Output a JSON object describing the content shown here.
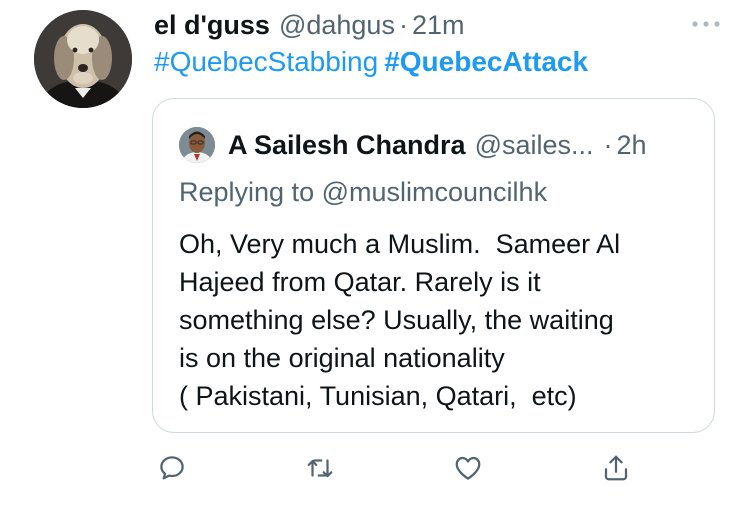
{
  "author": {
    "display_name": "el d'guss",
    "handle": "@dahgus",
    "separator": "·",
    "time": "21m",
    "avatar_icon": "dog-portrait-avatar"
  },
  "text": {
    "hashtags": [
      "#QuebecStabbing",
      "#QuebecAttack"
    ]
  },
  "quoted_tweet": {
    "display_name": "A Sailesh Chandra",
    "handle": "@sailes...",
    "separator": "·",
    "time": "2h",
    "replying_prefix": "Replying to",
    "replying_to": "@muslimcouncilhk",
    "body_lines": [
      "Oh, Very much a Muslim.  Sameer Al",
      "Hajeed from Qatar. Rarely is it",
      "something else? Usually, the waiting",
      "is on the original nationality",
      "( Pakistani, Tunisian, Qatari,  etc)"
    ]
  },
  "actions": {
    "icons": [
      "reply-icon",
      "retweet-icon",
      "like-icon",
      "share-icon"
    ]
  },
  "colors": {
    "link": "#1d9bf0",
    "secondary_text": "#536471",
    "border": "#cfd9de",
    "icon": "#536471"
  }
}
